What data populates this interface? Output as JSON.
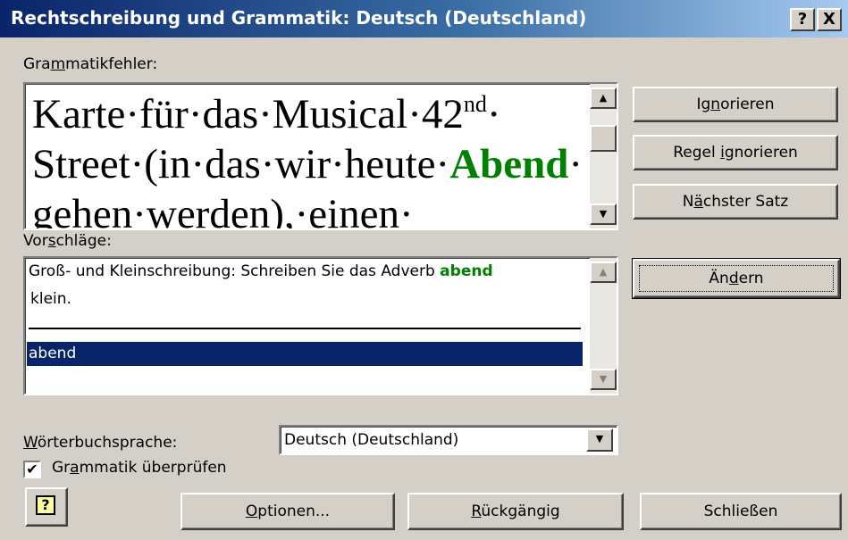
{
  "window": {
    "title": "Rechtschreibung und Grammatik: Deutsch (Deutschland)",
    "help_glyph": "?",
    "close_glyph": "X"
  },
  "grammar": {
    "label_pre": "Gra",
    "label_ul": "m",
    "label_post": "matikfehler:",
    "line1_a": "Karte·für·das·Musical·42",
    "line1_sup": "nd",
    "line1_b": "·",
    "line2_a": "Street·(in·das·wir·heute·",
    "line2_word": "Abend",
    "line2_b": "·",
    "line3": "gehen·werden),·einen·"
  },
  "suggestions": {
    "label_pre": "Vor",
    "label_ul": "s",
    "label_post": "chläge:",
    "msg_a": "Groß- und Kleinschreibung: Schreiben Sie das Adverb ",
    "msg_word": "abend",
    "msg_b": "klein.",
    "selected": "abend"
  },
  "buttons": {
    "ignore_pre": "Ig",
    "ignore_ul": "n",
    "ignore_post": "orieren",
    "ignore_rule_pre": "Regel ",
    "ignore_rule_ul": "i",
    "ignore_rule_post": "gnorieren",
    "next_pre": "N",
    "next_ul": "ä",
    "next_post": "chster Satz",
    "change_pre": "Än",
    "change_ul": "d",
    "change_post": "ern",
    "options_ul": "O",
    "options_post": "ptionen...",
    "undo_ul": "R",
    "undo_post": "ückgängig",
    "close": "Schließen"
  },
  "dictionary": {
    "label_ul": "W",
    "label_post": "örterbuchsprache:",
    "value": "Deutsch (Deutschland)"
  },
  "check_grammar": {
    "checked_glyph": "✔",
    "label_pre": "Gr",
    "label_ul": "a",
    "label_post": "mmatik überprüfen"
  }
}
